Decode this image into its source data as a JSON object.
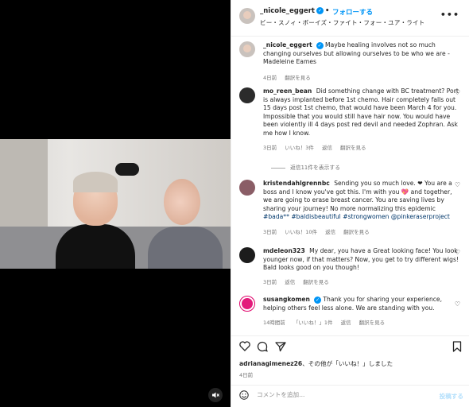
{
  "header": {
    "username": "_nicole_eggert",
    "follow_label": "フォローする",
    "audio": "ビー・スノィ・ボーイズ・ファイト・フォー・ユア・ライト",
    "more": "•••"
  },
  "caption": {
    "username": "_nicole_eggert",
    "text": "Maybe healing involves not so much changing ourselves but allowing ourselves to be who we are - Madeleine Eames",
    "time": "4日前",
    "translate": "翻訳を見る"
  },
  "comments": [
    {
      "username": "mo_reen_bean",
      "text": "Did something change with BC treatment? Port is always implanted before 1st chemo. Hair completely falls out 15 days post 1st chemo, that would have been March 4 for you. Impossible that you would still have hair now. You would have been violently ill 4 days post red devil and needed Zophran. Ask me how I know.",
      "time": "3日前",
      "likes": "いいね！3件",
      "reply": "返信",
      "translate": "翻訳を見る",
      "view_replies": "返信11件を表示する"
    },
    {
      "username": "kristendahlgrennbc",
      "text": "Sending you so much love. ❤ You are a boss and I know you've got this. I'm with you 💖 and together, we are going to erase breast cancer. You are saving lives by sharing your journey! No more normalizing this epidemic",
      "tags": "#bada** #baldisbeautiful #strongwomen @pinkeraserproject",
      "time": "3日前",
      "likes": "いいね！10件",
      "reply": "返信",
      "translate": "翻訳を見る"
    },
    {
      "username": "mdeleon323",
      "text": "My dear, you have a Great looking face! You look younger now, if that matters? Now, you get to try different wigs! Bald looks good on you though!",
      "time": "3日前",
      "reply": "返信",
      "translate": "翻訳を見る"
    },
    {
      "username": "susangkomen",
      "text": "Thank you for sharing your experience, helping others feel less alone. We are standing with you.",
      "time": "14時間前",
      "likes": "「いいね！」1件",
      "reply": "返信",
      "translate": "翻訳を見る"
    }
  ],
  "likes_line": {
    "user": "adrianagimenez26",
    "rest": "、その他が「いいね！」しました"
  },
  "post_date": "4日前",
  "composer": {
    "placeholder": "コメントを追加...",
    "post_label": "投稿する"
  },
  "colors": {
    "accent": "#0095f6",
    "muted": "#737373",
    "post_disabled": "#b2dffc"
  },
  "icons": [
    "verified-icon",
    "heart-icon",
    "comment-icon",
    "share-icon",
    "bookmark-icon",
    "emoji-icon",
    "mute-icon",
    "more-icon"
  ]
}
